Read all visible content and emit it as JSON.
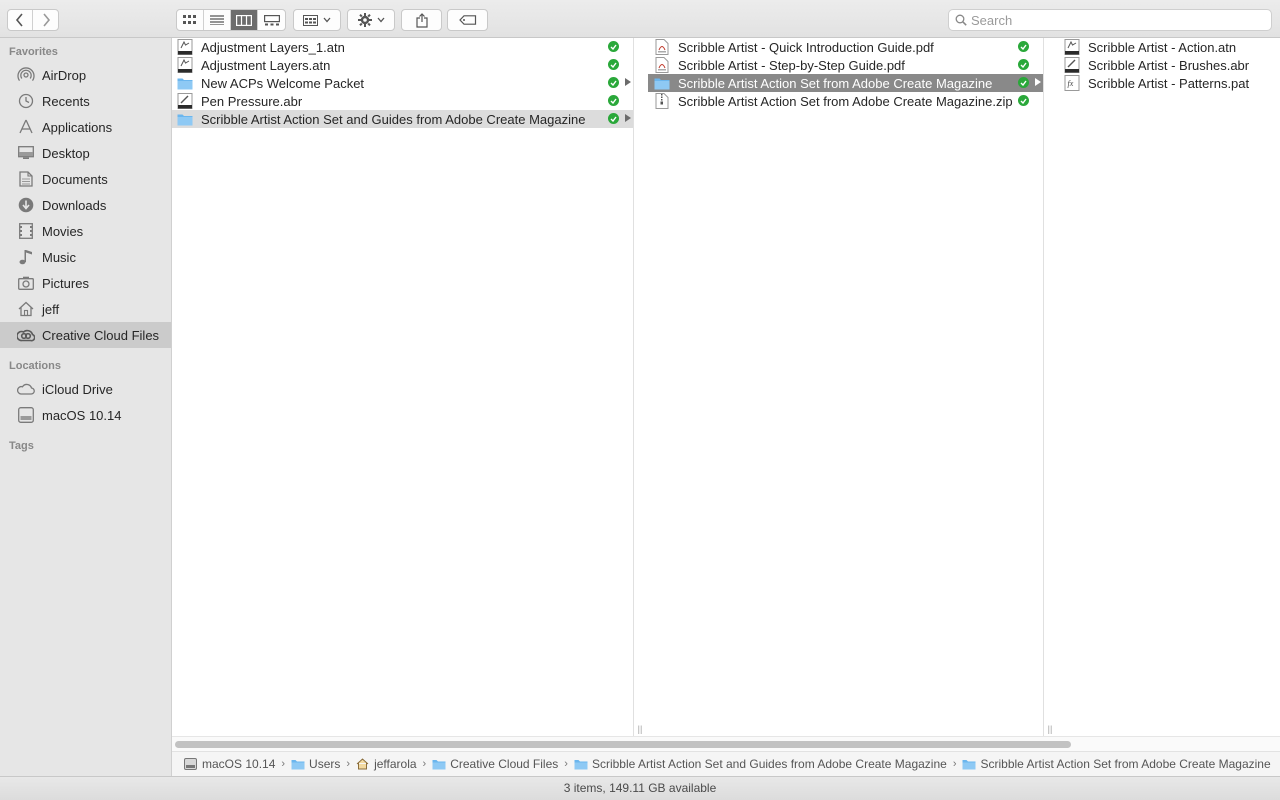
{
  "toolbar": {
    "search_placeholder": "Search"
  },
  "sidebar": {
    "favorites_header": "Favorites",
    "favorites": [
      {
        "label": "AirDrop",
        "icon": "airdrop-icon"
      },
      {
        "label": "Recents",
        "icon": "clock-icon"
      },
      {
        "label": "Applications",
        "icon": "applications-icon"
      },
      {
        "label": "Desktop",
        "icon": "desktop-icon"
      },
      {
        "label": "Documents",
        "icon": "document-icon"
      },
      {
        "label": "Downloads",
        "icon": "download-icon"
      },
      {
        "label": "Movies",
        "icon": "film-icon"
      },
      {
        "label": "Music",
        "icon": "music-note-icon"
      },
      {
        "label": "Pictures",
        "icon": "camera-icon"
      },
      {
        "label": "jeff",
        "icon": "home-icon"
      },
      {
        "label": "Creative Cloud Files",
        "icon": "creative-cloud-icon"
      }
    ],
    "locations_header": "Locations",
    "locations": [
      {
        "label": "iCloud Drive",
        "icon": "cloud-icon"
      },
      {
        "label": "macOS 10.14",
        "icon": "hard-drive-icon"
      }
    ],
    "tags_header": "Tags"
  },
  "columns": {
    "col1": [
      {
        "name": "Adjustment Layers_1.atn",
        "type": "atn"
      },
      {
        "name": "Adjustment Layers.atn",
        "type": "atn"
      },
      {
        "name": "New ACPs Welcome Packet",
        "type": "folder"
      },
      {
        "name": "Pen Pressure.abr",
        "type": "abr"
      },
      {
        "name": "Scribble Artist Action Set and Guides from Adobe Create Magazine",
        "type": "folder"
      }
    ],
    "col2": [
      {
        "name": "Scribble Artist - Quick Introduction Guide.pdf",
        "type": "pdf"
      },
      {
        "name": "Scribble Artist - Step-by-Step Guide.pdf",
        "type": "pdf"
      },
      {
        "name": "Scribble Artist Action Set from Adobe Create Magazine",
        "type": "folder"
      },
      {
        "name": "Scribble Artist Action Set from Adobe Create Magazine.zip",
        "type": "zip"
      }
    ],
    "col3": [
      {
        "name": "Scribble Artist - Action.atn",
        "type": "atn"
      },
      {
        "name": "Scribble Artist - Brushes.abr",
        "type": "abr"
      },
      {
        "name": "Scribble Artist - Patterns.pat",
        "type": "pat"
      }
    ]
  },
  "pathbar": [
    {
      "label": "macOS 10.14",
      "icon": "hard-drive-icon"
    },
    {
      "label": "Users",
      "icon": "folder-icon"
    },
    {
      "label": "jeffarola",
      "icon": "home-icon"
    },
    {
      "label": "Creative Cloud Files",
      "icon": "folder-icon"
    },
    {
      "label": "Scribble Artist Action Set and Guides from Adobe Create Magazine",
      "icon": "folder-icon"
    },
    {
      "label": "Scribble Artist Action Set from Adobe Create Magazine",
      "icon": "folder-icon"
    }
  ],
  "status": {
    "text": "3 items, 149.11 GB available"
  },
  "colors": {
    "sync_green": "#2aa83a",
    "folder_blue": "#6bb6ee",
    "selection_dark": "#898989"
  }
}
